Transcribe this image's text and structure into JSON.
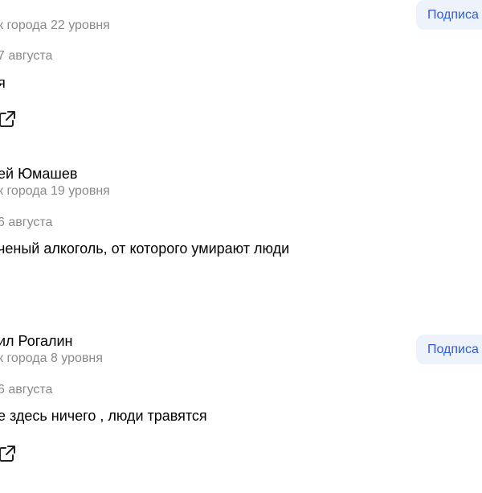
{
  "reviews": [
    {
      "author": "…",
      "level": "к города 22 уровня",
      "date": "7 августа",
      "text": "я",
      "subscribe_label": "Подписа"
    },
    {
      "author": "ей Юмашев",
      "level": "к города 19 уровня",
      "date": "6 августа",
      "text": "ченый алкоголь, от которого умирают люди"
    },
    {
      "author": "ил Рогалин",
      "level": "к города 8 уровня",
      "date": "6 августа",
      "text": "е здесь ничего , люди травятся",
      "subscribe_label": "Подписа"
    }
  ],
  "icons": {
    "share": "share-external-icon"
  }
}
